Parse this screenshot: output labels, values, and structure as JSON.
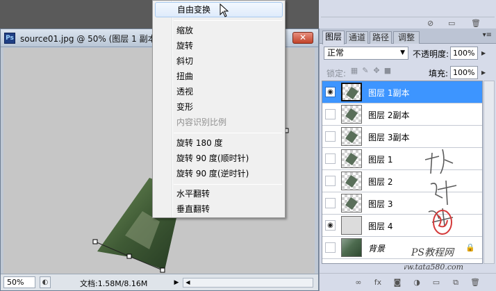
{
  "document": {
    "title": "source01.jpg @ 50% (图层 1 副本, ",
    "close_glyph": "✕",
    "ps_badge": "Ps",
    "zoom": "50%",
    "doc_size": "文档:1.58M/8.16M"
  },
  "context_menu": {
    "items": [
      {
        "label": "自由变换",
        "state": "highlighted"
      },
      {
        "label": "缩放",
        "state": "normal"
      },
      {
        "label": "旋转",
        "state": "normal"
      },
      {
        "label": "斜切",
        "state": "normal"
      },
      {
        "label": "扭曲",
        "state": "normal"
      },
      {
        "label": "透视",
        "state": "normal"
      },
      {
        "label": "变形",
        "state": "normal"
      },
      {
        "label": "内容识别比例",
        "state": "disabled"
      },
      {
        "label": "旋转 180 度",
        "state": "normal"
      },
      {
        "label": "旋转 90 度(顺时针)",
        "state": "normal"
      },
      {
        "label": "旋转 90 度(逆时针)",
        "state": "normal"
      },
      {
        "label": "水平翻转",
        "state": "normal"
      },
      {
        "label": "垂直翻转",
        "state": "normal"
      }
    ]
  },
  "layers_panel": {
    "tabs": [
      {
        "label": "图层",
        "active": true
      },
      {
        "label": "通道",
        "active": false
      },
      {
        "label": "路径",
        "active": false
      },
      {
        "label": "调整",
        "active": false
      }
    ],
    "blend_mode": "正常",
    "opacity_label": "不透明度:",
    "opacity_value": "100%",
    "lock_label": "锁定:",
    "fill_label": "填充:",
    "fill_value": "100%",
    "layers": [
      {
        "name": "图层 1副本",
        "visible": true,
        "selected": true,
        "thumb": "transparent"
      },
      {
        "name": "图层 2副本",
        "visible": false,
        "selected": false,
        "thumb": "transparent"
      },
      {
        "name": "图层 3副本",
        "visible": false,
        "selected": false,
        "thumb": "transparent"
      },
      {
        "name": "图层 1",
        "visible": false,
        "selected": false,
        "thumb": "transparent"
      },
      {
        "name": "图层 2",
        "visible": false,
        "selected": false,
        "thumb": "transparent"
      },
      {
        "name": "图层 3",
        "visible": false,
        "selected": false,
        "thumb": "transparent"
      },
      {
        "name": "图层 4",
        "visible": true,
        "selected": false,
        "thumb": "solid"
      },
      {
        "name": "背景",
        "visible": false,
        "selected": false,
        "thumb": "photo",
        "locked": true
      }
    ]
  },
  "watermark": {
    "line1": "PS教程网",
    "line2": "www.tata580.com"
  },
  "colors": {
    "selection": "#3d95ff",
    "menu_highlight": "#deebfb",
    "panel_bg": "#d6dbe9"
  }
}
